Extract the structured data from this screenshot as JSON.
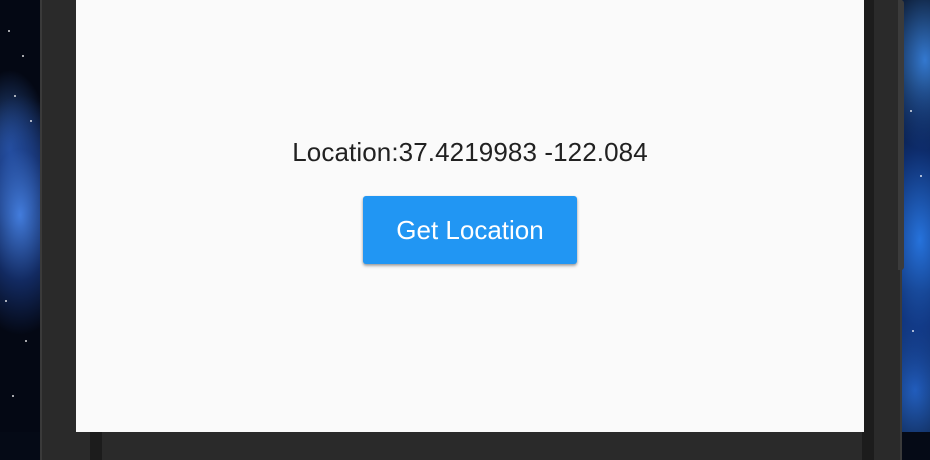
{
  "app": {
    "location_label": "Location:37.4219983 -122.084",
    "get_location_button_label": "Get Location"
  },
  "colors": {
    "screen_background": "#fafafa",
    "button_background": "#2196f3",
    "button_text": "#ffffff",
    "body_text": "#212121",
    "frame": "#2a2a2a"
  }
}
